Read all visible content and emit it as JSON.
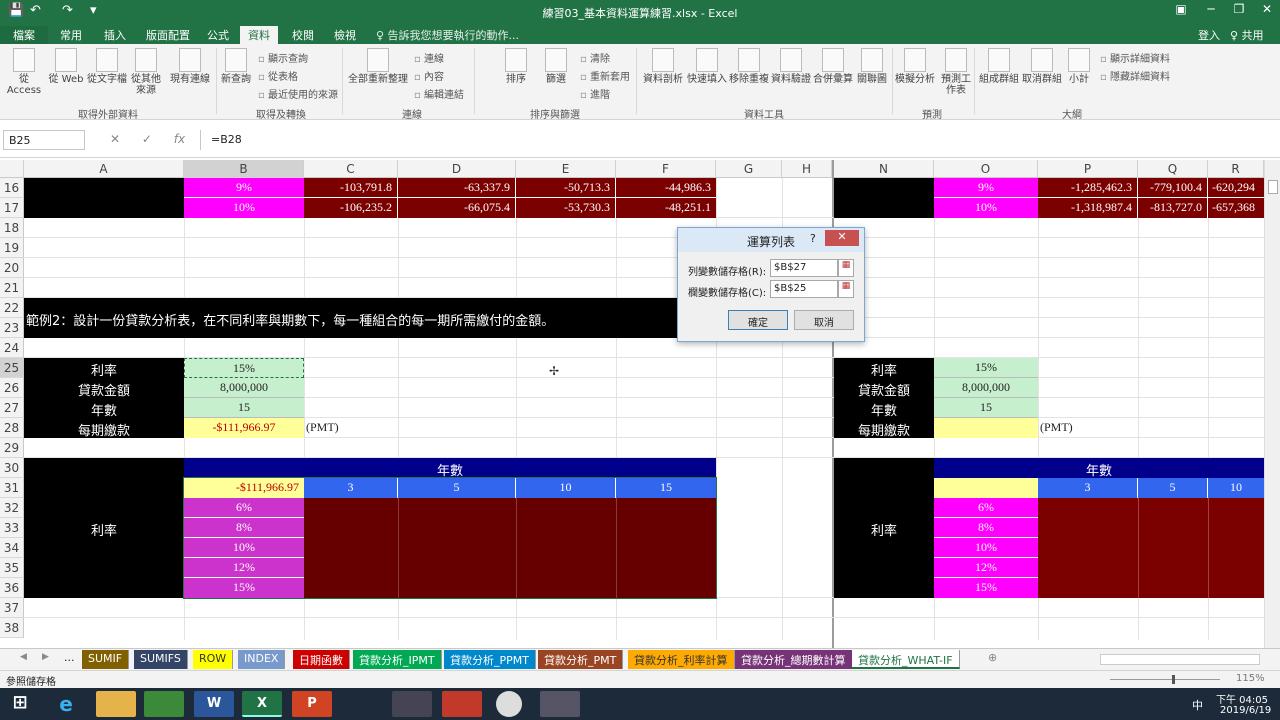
{
  "window": {
    "title": "練習03_基本資料運算練習.xlsx - Excel",
    "min": "─",
    "restore": "❐",
    "close": "✕",
    "display": "▣"
  },
  "qat": {
    "save": "💾",
    "undo": "↶",
    "redo": "↷",
    "more": "▾"
  },
  "tabs": [
    "檔案",
    "常用",
    "插入",
    "版面配置",
    "公式",
    "資料",
    "校閱",
    "檢視"
  ],
  "search": "♀ 告訴我您想要執行的動作...",
  "account": {
    "signin": "登入",
    "share": "♀ 共用"
  },
  "ribbon": {
    "buttons": [
      "從 Access",
      "從 Web",
      "從文字檔",
      "從其他來源",
      "現有連線",
      "新查詢",
      "全部重新整理",
      "排序",
      "篩選",
      "資料剖析",
      "快速填入",
      "移除重複",
      "資料驗證",
      "合併彙算",
      "關聯圖",
      "模擬分析",
      "預測工作表",
      "組成群組",
      "取消群組",
      "小計"
    ],
    "small": [
      "顯示查詢",
      "從表格",
      "最近使用的來源",
      "連線",
      "內容",
      "編輯連結",
      "清除",
      "重新套用",
      "進階",
      "顯示詳細資料",
      "隱藏詳細資料"
    ],
    "groups": [
      "取得外部資料",
      "取得及轉換",
      "連線",
      "排序與篩選",
      "資料工具",
      "預測",
      "大綱"
    ]
  },
  "formula": {
    "namebox": "B25",
    "cancel": "✕",
    "enter": "✓",
    "fx": "fx",
    "content": "=B28"
  },
  "columns": [
    "A",
    "B",
    "C",
    "D",
    "E",
    "F",
    "G",
    "H",
    "N",
    "O",
    "P",
    "Q",
    "R"
  ],
  "rows": [
    "16",
    "17",
    "18",
    "19",
    "20",
    "21",
    "22",
    "23",
    "24",
    "25",
    "26",
    "27",
    "28",
    "29",
    "30",
    "31",
    "32",
    "33",
    "34",
    "35",
    "36",
    "37",
    "38"
  ],
  "rows1617": {
    "b": [
      "9%",
      "10%"
    ],
    "c": [
      "-103,791.8",
      "-106,235.2"
    ],
    "d": [
      "-63,337.9",
      "-66,075.4"
    ],
    "e": [
      "-50,713.3",
      "-53,730.3"
    ],
    "f": [
      "-44,986.3",
      "-48,251.1"
    ],
    "o": [
      "9%",
      "10%"
    ],
    "p": [
      "-1,285,462.3",
      "-1,318,987.4"
    ],
    "q": [
      "-779,100.4",
      "-813,727.0"
    ],
    "r": [
      "-620,294",
      "-657,368"
    ]
  },
  "example": "範例2：設計一份貸款分析表，在不同利率與期數下，每一種組合的每一期所需繳付的金額。",
  "labels": [
    "利率",
    "貸款金額",
    "年數",
    "每期繳款"
  ],
  "values": {
    "rate": "15%",
    "amount": "8,000,000",
    "years": "15",
    "pmt": "-$111,966.97"
  },
  "pmt_note": "(PMT)",
  "table": {
    "years_header": "年數",
    "rate_label": "利率",
    "corner": "-$111,966.97",
    "years": [
      "3",
      "5",
      "10",
      "15"
    ],
    "rates": [
      "6%",
      "8%",
      "10%",
      "12%",
      "15%"
    ],
    "right_years": [
      "3",
      "5",
      "10"
    ]
  },
  "dialog": {
    "title": "運算列表",
    "help": "?",
    "close": "✕",
    "row_label": "列變數儲存格(R):",
    "row_value": "$B$27",
    "col_label": "欄變數儲存格(C):",
    "col_value": "$B$25",
    "ok": "確定",
    "cancel": "取消",
    "ref_icon": "▦"
  },
  "sheet_tabs": [
    "SUMIF",
    "SUMIFS",
    "ROW",
    "INDEX",
    "日期函數",
    "貸款分析_IPMT",
    "貸款分析_PPMT",
    "貸款分析_PMT",
    "貸款分析_利率計算",
    "貸款分析_總期數計算",
    "貸款分析_WHAT-IF"
  ],
  "sheet_nav": {
    "prev": "◀",
    "next": "▶",
    "more": "...",
    "add": "⊕"
  },
  "status": {
    "mode": "參照儲存格",
    "zoom": "115%"
  },
  "taskbar": {
    "time": "下午 04:05",
    "date": "2019/6/19",
    "ime": "中",
    "start": "⊞"
  },
  "colors": {
    "magenta": "#ff00ff",
    "maroon": "#7b0000",
    "blue": "#3366ee",
    "navy": "#00008b",
    "green_light": "#c6efce",
    "yellow": "#ffff99",
    "orchid": "#cc33cc"
  }
}
